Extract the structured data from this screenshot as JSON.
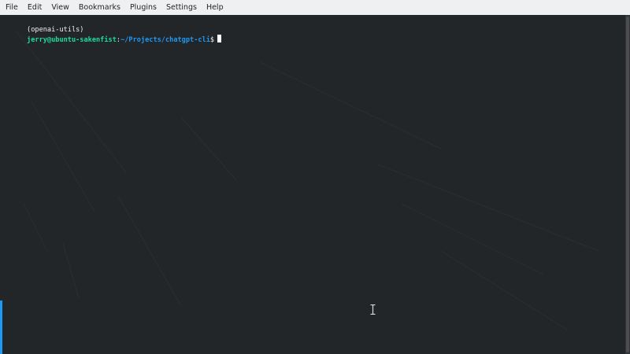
{
  "menubar": {
    "items": [
      {
        "label": "File",
        "name": "menu-file"
      },
      {
        "label": "Edit",
        "name": "menu-edit"
      },
      {
        "label": "View",
        "name": "menu-view"
      },
      {
        "label": "Bookmarks",
        "name": "menu-bookmarks"
      },
      {
        "label": "Plugins",
        "name": "menu-plugins"
      },
      {
        "label": "Settings",
        "name": "menu-settings"
      },
      {
        "label": "Help",
        "name": "menu-help"
      }
    ]
  },
  "terminal": {
    "prompt": {
      "venv": "(openai-utils)",
      "userhost": "jerry@ubuntu-sakenfist",
      "colon": ":",
      "path": "~/Projects/chatgpt-cli",
      "dollar": "$"
    },
    "mouse_cursor_icon": "text-ibeam-icon"
  },
  "colors": {
    "menubar_bg": "#eff0f1",
    "terminal_bg": "#232629",
    "userhost": "#1cdc9a",
    "path": "#1d99f3",
    "accent": "#1d99f3"
  }
}
